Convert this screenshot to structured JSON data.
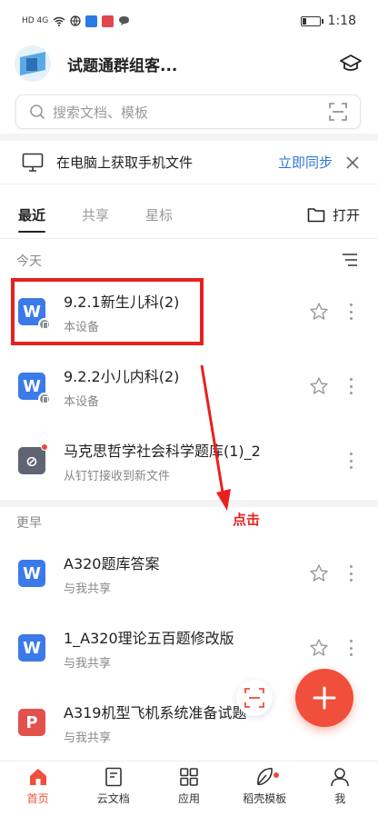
{
  "status_bar": {
    "left_text": "HD 4G",
    "time": "1:18"
  },
  "header": {
    "title": "试题通群组客..."
  },
  "search": {
    "placeholder": "搜索文档、模板"
  },
  "sync_bar": {
    "text": "在电脑上获取手机文件",
    "action": "立即同步"
  },
  "tabs": [
    {
      "label": "最近",
      "active": true
    },
    {
      "label": "共享",
      "active": false
    },
    {
      "label": "星标",
      "active": false
    }
  ],
  "open_button": "打开",
  "sections": {
    "today": "今天",
    "earlier": "更早"
  },
  "files_today": [
    {
      "name": "9.2.1新生儿科(2)",
      "sub": "本设备",
      "type": "doc",
      "icon": "W"
    },
    {
      "name": "9.2.2小儿内科(2)",
      "sub": "本设备",
      "type": "doc",
      "icon": "W"
    },
    {
      "name": "马克思哲学社会科学题库(1)_2",
      "sub": "从钉钉接收到新文件",
      "type": "other",
      "icon": "⊘"
    }
  ],
  "files_earlier": [
    {
      "name": "A320题库答案",
      "sub": "与我共享",
      "type": "doc",
      "icon": "W"
    },
    {
      "name": "1_A320理论五百题修改版",
      "sub": "与我共享",
      "type": "doc",
      "icon": "W"
    },
    {
      "name": "A319机型飞机系统准备试题",
      "sub": "与我共享",
      "type": "pdf",
      "icon": "P"
    }
  ],
  "annotation": "点击",
  "bottom_nav": [
    {
      "label": "首页",
      "icon": "home-icon"
    },
    {
      "label": "云文档",
      "icon": "cloud-doc-icon"
    },
    {
      "label": "应用",
      "icon": "apps-icon"
    },
    {
      "label": "稻壳模板",
      "icon": "template-icon"
    },
    {
      "label": "我",
      "icon": "profile-icon"
    }
  ],
  "colors": {
    "accent": "#ef4f3b",
    "link": "#2c78d6",
    "highlight": "#e8211f",
    "doc_blue": "#3b7ae8"
  }
}
